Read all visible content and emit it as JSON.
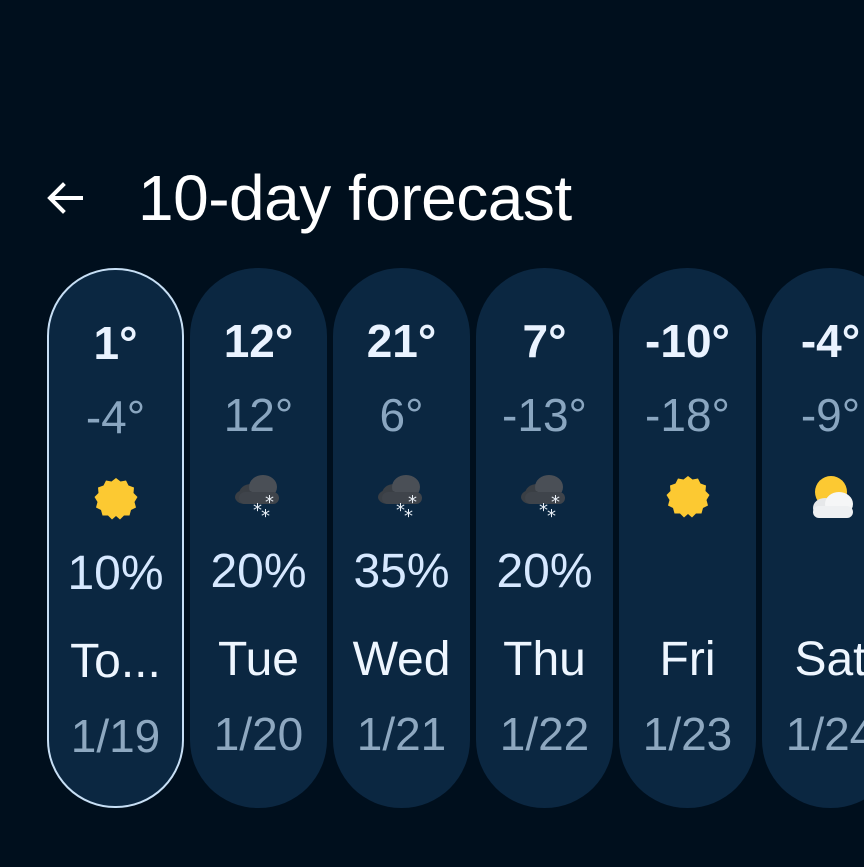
{
  "header": {
    "title": "10-day forecast"
  },
  "days": [
    {
      "high": "1°",
      "low": "-4°",
      "icon": "sunny-icon",
      "precip": "10%",
      "day": "To...",
      "date": "1/19",
      "selected": true
    },
    {
      "high": "12°",
      "low": "12°",
      "icon": "snow-cloud-icon",
      "precip": "20%",
      "day": "Tue",
      "date": "1/20"
    },
    {
      "high": "21°",
      "low": "6°",
      "icon": "snow-cloud-icon",
      "precip": "35%",
      "day": "Wed",
      "date": "1/21"
    },
    {
      "high": "7°",
      "low": "-13°",
      "icon": "snow-cloud-icon",
      "precip": "20%",
      "day": "Thu",
      "date": "1/22"
    },
    {
      "high": "-10°",
      "low": "-18°",
      "icon": "sunny-icon",
      "precip": "",
      "day": "Fri",
      "date": "1/23"
    },
    {
      "high": "-4°",
      "low": "-9°",
      "icon": "partly-cloudy-icon",
      "precip": "",
      "day": "Sat",
      "date": "1/24"
    }
  ],
  "colors": {
    "background": "#000f1d",
    "card": "#0b2741",
    "selected_border": "#c7dff5",
    "sun": "#fcc932"
  }
}
